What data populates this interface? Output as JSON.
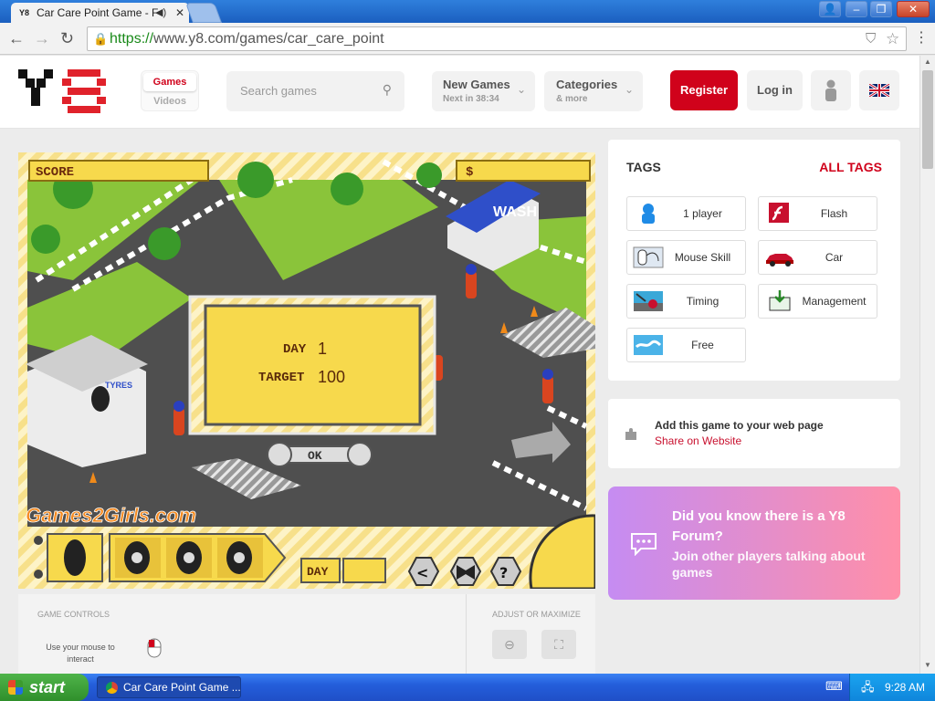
{
  "browser": {
    "tab_title": "Car Care Point Game - F",
    "url_scheme": "https://",
    "url_rest": "www.y8.com/games/car_care_point",
    "favicon": "y8-icon"
  },
  "header": {
    "logo": "Y8",
    "nav_games": "Games",
    "nav_videos": "Videos",
    "search_placeholder": "Search games",
    "new_games_label": "New Games",
    "new_games_sub": "Next in 38:34",
    "categories_label": "Categories",
    "categories_sub": "& more",
    "register_label": "Register",
    "login_label": "Log in"
  },
  "game": {
    "score_label": "SCORE",
    "money_label": "$",
    "wash_label": "WASH",
    "tyres_label": "TYRES",
    "day_label": "DAY",
    "day_value": "1",
    "target_label": "TARGET",
    "target_value": "100",
    "ok_label": "OK",
    "brand": "Games2Girls.com",
    "bottom_day_label": "DAY",
    "help_label": "?"
  },
  "controls": {
    "game_controls_label": "GAME CONTROLS",
    "mouse_hint": "Use your mouse to interact",
    "adjust_label": "ADJUST OR MAXIMIZE"
  },
  "tags": {
    "title": "TAGS",
    "all_tags": "ALL TAGS",
    "items": [
      {
        "label": "1 player",
        "icon": "player-icon"
      },
      {
        "label": "Flash",
        "icon": "flash-icon"
      },
      {
        "label": "Mouse Skill",
        "icon": "mouse-skill-icon"
      },
      {
        "label": "Car",
        "icon": "car-icon"
      },
      {
        "label": "Timing",
        "icon": "timing-icon"
      },
      {
        "label": "Management",
        "icon": "management-icon"
      },
      {
        "label": "Free",
        "icon": "free-icon"
      }
    ]
  },
  "embed": {
    "title": "Add this game to your web page",
    "link": "Share on Website"
  },
  "forum": {
    "title": "Did you know there is a Y8 Forum?",
    "text": "Join other players talking about games"
  },
  "taskbar": {
    "start": "start",
    "task": "Car Care Point Game ...",
    "time": "9:28 AM"
  },
  "colors": {
    "accent_red": "#d0021b",
    "link_red": "#c8102e",
    "forum_start": "#c58cf2",
    "forum_end": "#ff8fa8",
    "game_yellow": "#f7d94c"
  }
}
